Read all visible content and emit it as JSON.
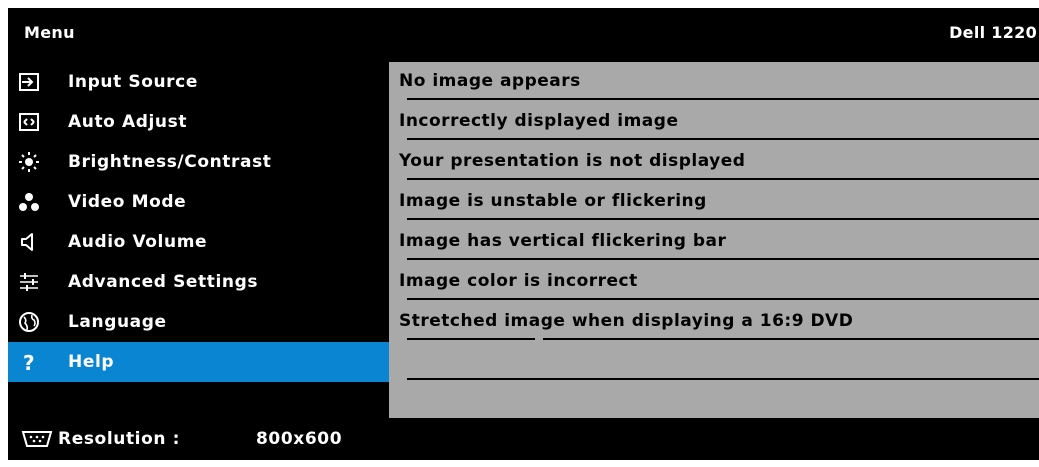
{
  "header": {
    "title": "Menu",
    "device_name": "Dell 1220"
  },
  "menu": {
    "active_color": "#0a85d2",
    "items": [
      {
        "label": "Input Source",
        "icon": "input-source-icon"
      },
      {
        "label": "Auto Adjust",
        "icon": "auto-adjust-icon"
      },
      {
        "label": "Brightness/Contrast",
        "icon": "brightness-icon"
      },
      {
        "label": "Video Mode",
        "icon": "video-mode-icon"
      },
      {
        "label": "Audio Volume",
        "icon": "speaker-icon"
      },
      {
        "label": "Advanced Settings",
        "icon": "sliders-icon"
      },
      {
        "label": "Language",
        "icon": "globe-icon"
      },
      {
        "label": "Help",
        "icon": "question-icon",
        "selected": true
      }
    ]
  },
  "help_panel": {
    "items": [
      "No image appears",
      "Incorrectly displayed image",
      "Your presentation is not displayed",
      "Image is unstable or flickering",
      "Image has vertical flickering bar",
      "Image color is incorrect",
      "Stretched image when displaying a 16:9 DVD"
    ]
  },
  "status": {
    "label": "Resolution :",
    "value": "800x600",
    "icon": "vga-connector-icon"
  }
}
